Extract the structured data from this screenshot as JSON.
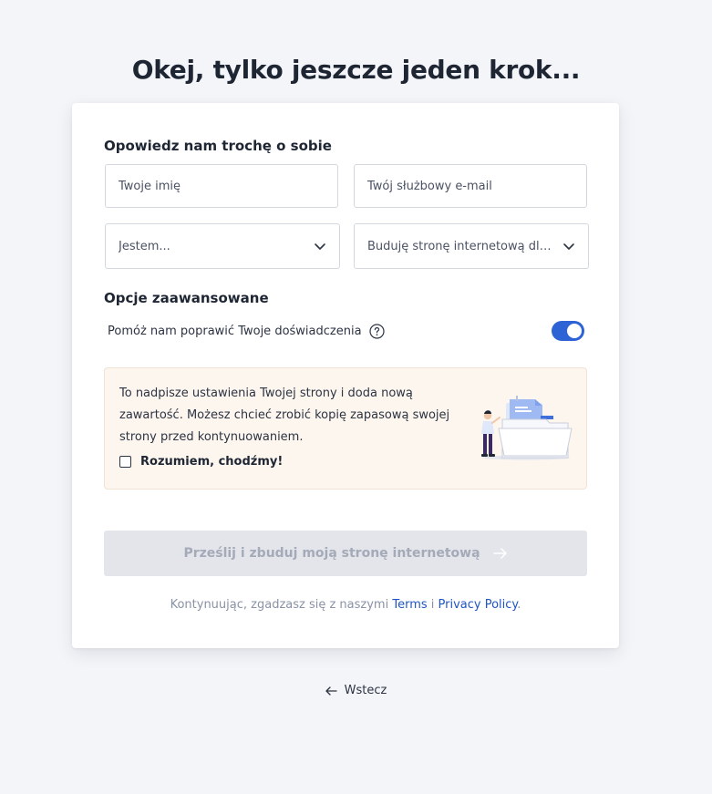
{
  "page": {
    "title": "Okej, tylko jeszcze jeden krok..."
  },
  "form": {
    "about_title": "Opowiedz nam trochę o sobie",
    "name_placeholder": "Twoje imię",
    "email_placeholder": "Twój służbowy e-mail",
    "role_select": "Jestem...",
    "purpose_select": "Buduję stronę internetową dla..."
  },
  "advanced": {
    "title": "Opcje zaawansowane",
    "toggle_label": "Pomóż nam poprawić Twoje doświadczenia",
    "toggle_on": true
  },
  "notice": {
    "text": "To nadpisze ustawienia Twojej strony i doda nową zawartość. Możesz chcieć zrobić kopię zapasową swojej strony przed kontynuowaniem.",
    "checkbox_label": "Rozumiem, chodźmy!",
    "checked": false
  },
  "submit": {
    "label": "Prześlij i zbuduj moją stronę internetową",
    "disabled": true
  },
  "legal": {
    "prefix": "Kontynuując, zgadzasz się z naszymi ",
    "terms": "Terms",
    "conjunction": " i ",
    "privacy": "Privacy Policy",
    "suffix": "."
  },
  "back": {
    "label": "Wstecz"
  },
  "icons": {
    "chevron": "chevron-down-icon",
    "help": "question-circle-icon",
    "arrow_right": "arrow-right-icon",
    "arrow_left": "arrow-left-icon"
  },
  "colors": {
    "accent": "#2e63d6",
    "link": "#1f55c4",
    "notice_bg": "#fdf6ef",
    "disabled_bg": "#e3e5ea"
  }
}
